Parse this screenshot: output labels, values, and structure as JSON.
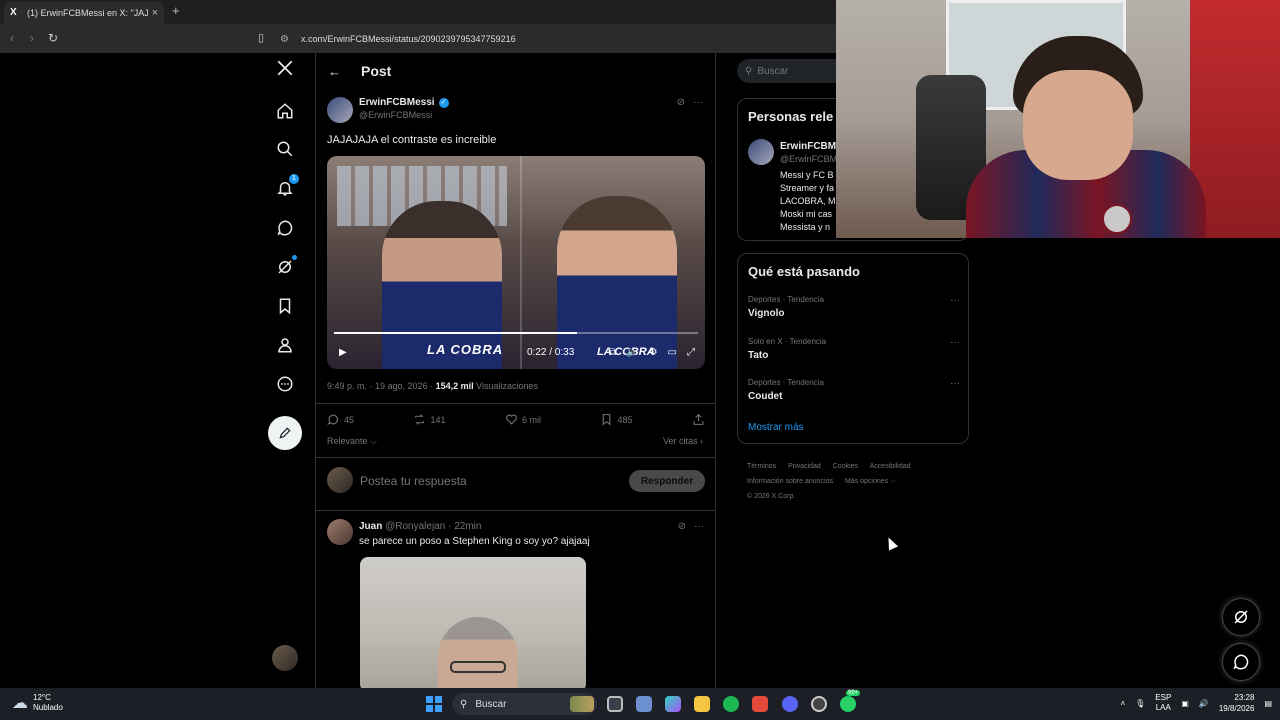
{
  "browser": {
    "tab_title": "(1) ErwinFCBMessi en X: \"JAJAJA",
    "tab_favicon": "X",
    "close_glyph": "×",
    "new_tab_glyph": "+",
    "url": "x.com/ErwinFCBMessi/status/2090239795347759216"
  },
  "nav": {
    "items": [
      "home-icon",
      "search-icon",
      "bell-icon",
      "chat-icon",
      "grok-icon",
      "bookmark-icon",
      "profile-icon",
      "more-icon"
    ],
    "notifications_badge": "1"
  },
  "header": {
    "back_glyph": "←",
    "title": "Post"
  },
  "post": {
    "author_name": "ErwinFCBMessi",
    "verified_glyph": "✓",
    "author_handle": "@ErwinFCBMessi",
    "more_glyph": "···",
    "text": "JAJAJAJA el contraste es increible",
    "video": {
      "logo_left": "LA COBRA",
      "logo_right": "LA COBRA",
      "time": "0:22 / 0:33",
      "progress": 0.667
    },
    "time": "9:49 p. m. · 19 ago. 2026 · ",
    "views_count": "154,2 mil",
    "views_label": " Visualizaciones",
    "replies": "45",
    "reposts": "141",
    "likes": "6 mil",
    "bookmarks": "485",
    "sort_label": "Relevante",
    "quotes_label": "Ver citas ›"
  },
  "reply_box": {
    "placeholder": "Postea tu respuesta",
    "button": "Responder"
  },
  "reply": {
    "name": "Juan",
    "meta": " @Ronyalejan · 22min",
    "text": "se parece un poso a Stephen King o soy yo? ajajaaj"
  },
  "sidebar": {
    "search_placeholder": "Buscar",
    "people_title": "Personas rele",
    "person_name": "ErwinFCBMe",
    "person_handle": "@ErwinFCBM",
    "person_bio": [
      "Messi y FC B",
      "Streamer y fa",
      "LACOBRA, M",
      "Moski mi cas",
      "Messista y n"
    ],
    "trends_title": "Qué está pasando",
    "trends": [
      {
        "category": "Deportes · Tendencia",
        "term": "Vignolo"
      },
      {
        "category": "Solo en X · Tendencia",
        "term": "Tato"
      },
      {
        "category": "Deportes · Tendencia",
        "term": "Coudet"
      }
    ],
    "show_more": "Mostrar más",
    "footer_links": [
      "Términos",
      "Privacidad",
      "Cookies",
      "Accesibilidad",
      "Información sobre anuncios",
      "Más opciones ···"
    ],
    "copyright": "© 2026 X Corp."
  },
  "taskbar": {
    "temp": "12°C",
    "weather": "Nublado",
    "search": "Buscar",
    "lang_top": "ESP",
    "lang_bottom": "LAA",
    "time": "23:28",
    "date": "19/8/2026",
    "app_badge": "99+"
  }
}
